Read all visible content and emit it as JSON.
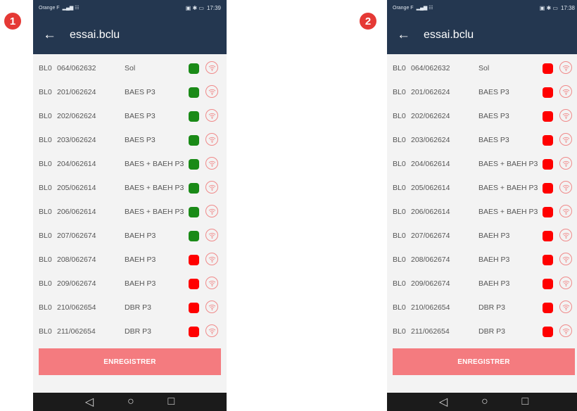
{
  "markers": [
    "1",
    "2"
  ],
  "screens": [
    {
      "status": {
        "carrier": "Orange F",
        "time": "17:39"
      },
      "title": "essai.bclu",
      "rows": [
        {
          "block": "BL0",
          "code": "064/062632",
          "label": "Sol",
          "status": "green"
        },
        {
          "block": "BL0",
          "code": "201/062624",
          "label": "BAES P3",
          "status": "green"
        },
        {
          "block": "BL0",
          "code": "202/062624",
          "label": "BAES P3",
          "status": "green"
        },
        {
          "block": "BL0",
          "code": "203/062624",
          "label": "BAES P3",
          "status": "green"
        },
        {
          "block": "BL0",
          "code": "204/062614",
          "label": "BAES + BAEH P3",
          "status": "green"
        },
        {
          "block": "BL0",
          "code": "205/062614",
          "label": "BAES + BAEH P3",
          "status": "green"
        },
        {
          "block": "BL0",
          "code": "206/062614",
          "label": "BAES + BAEH P3",
          "status": "green"
        },
        {
          "block": "BL0",
          "code": "207/062674",
          "label": "BAEH P3",
          "status": "green"
        },
        {
          "block": "BL0",
          "code": "208/062674",
          "label": "BAEH P3",
          "status": "red"
        },
        {
          "block": "BL0",
          "code": "209/062674",
          "label": "BAEH P3",
          "status": "red"
        },
        {
          "block": "BL0",
          "code": "210/062654",
          "label": "DBR P3",
          "status": "red"
        },
        {
          "block": "BL0",
          "code": "211/062654",
          "label": "DBR P3",
          "status": "red"
        }
      ],
      "save_label": "ENREGISTRER"
    },
    {
      "status": {
        "carrier": "Orange F",
        "time": "17:38"
      },
      "title": "essai.bclu",
      "rows": [
        {
          "block": "BL0",
          "code": "064/062632",
          "label": "Sol",
          "status": "red"
        },
        {
          "block": "BL0",
          "code": "201/062624",
          "label": "BAES P3",
          "status": "red"
        },
        {
          "block": "BL0",
          "code": "202/062624",
          "label": "BAES P3",
          "status": "red"
        },
        {
          "block": "BL0",
          "code": "203/062624",
          "label": "BAES P3",
          "status": "red"
        },
        {
          "block": "BL0",
          "code": "204/062614",
          "label": "BAES + BAEH P3",
          "status": "red"
        },
        {
          "block": "BL0",
          "code": "205/062614",
          "label": "BAES + BAEH P3",
          "status": "red"
        },
        {
          "block": "BL0",
          "code": "206/062614",
          "label": "BAES + BAEH P3",
          "status": "red"
        },
        {
          "block": "BL0",
          "code": "207/062674",
          "label": "BAEH P3",
          "status": "red"
        },
        {
          "block": "BL0",
          "code": "208/062674",
          "label": "BAEH P3",
          "status": "red"
        },
        {
          "block": "BL0",
          "code": "209/062674",
          "label": "BAEH P3",
          "status": "red"
        },
        {
          "block": "BL0",
          "code": "210/062654",
          "label": "DBR P3",
          "status": "red"
        },
        {
          "block": "BL0",
          "code": "211/062654",
          "label": "DBR P3",
          "status": "red"
        }
      ],
      "save_label": "ENREGISTRER"
    }
  ],
  "colors": {
    "header": "#243750",
    "green": "#1a8a17",
    "red": "#ff0000",
    "button": "#f47b7f",
    "wifi_icon": "#f08a8a"
  },
  "icons": {
    "back": "arrow-left-icon",
    "row_action": "wifi-signal-icon",
    "nav": [
      "nav-back-icon",
      "nav-home-icon",
      "nav-recents-icon"
    ]
  }
}
